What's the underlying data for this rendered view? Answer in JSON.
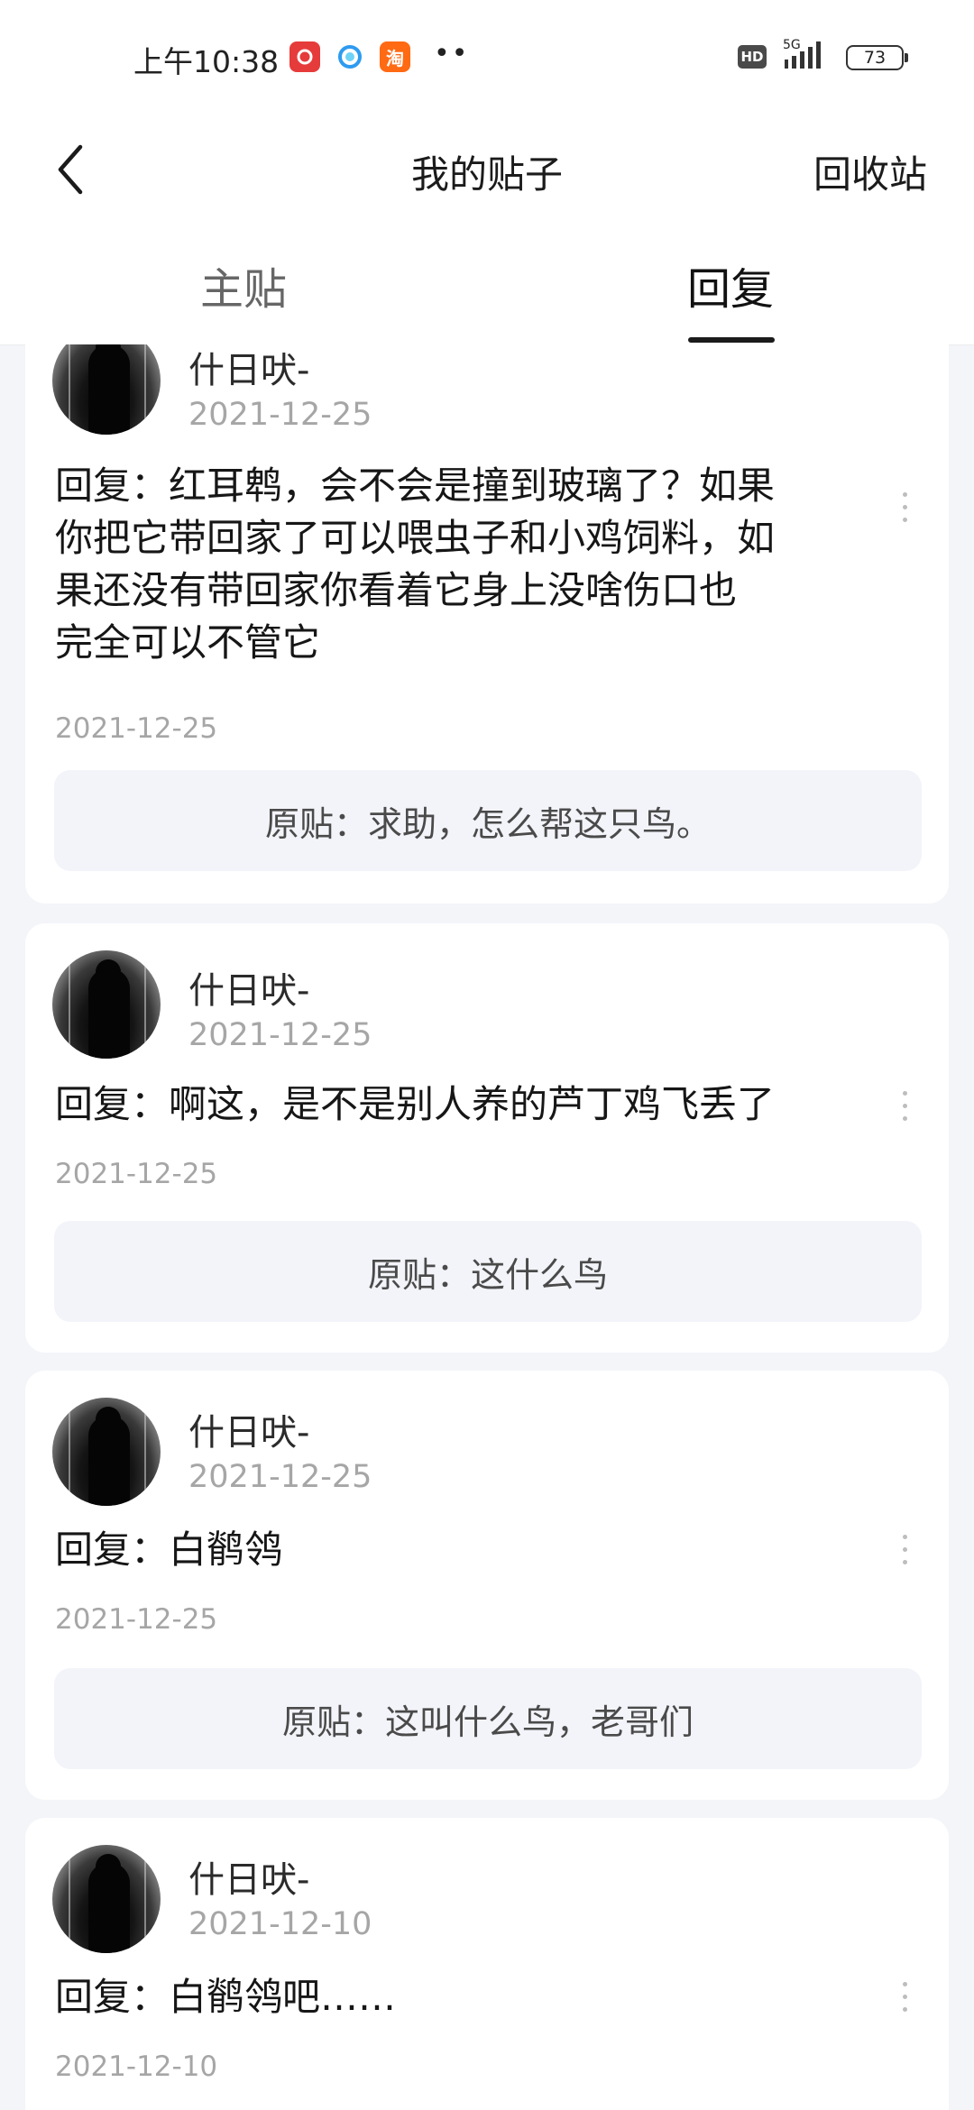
{
  "status_bar": {
    "time": "上午10:38",
    "taobao_icon_text": "淘",
    "hd_label": "HD",
    "network_label": "5G",
    "battery_level": "73"
  },
  "header": {
    "back_icon": "chevron-left-icon",
    "title": "我的贴子",
    "recycle_bin": "回收站"
  },
  "tabs": [
    {
      "label": "主贴",
      "active": false
    },
    {
      "label": "回复",
      "active": true
    }
  ],
  "posts": [
    {
      "username": "什日吠-",
      "user_date": "2021-12-25",
      "reply_lines": [
        "回复：红耳鹎，会不会是撞到玻璃了？如果",
        "你把它带回家了可以喂虫子和小鸡饲料，如",
        "果还没有带回家你看着它身上没啥伤口也",
        "完全可以不管它"
      ],
      "reply_date": "2021-12-25",
      "original_post": "原贴：求助，怎么帮这只鸟。"
    },
    {
      "username": "什日吠-",
      "user_date": "2021-12-25",
      "reply_lines": [
        "回复：啊这，是不是别人养的芦丁鸡飞丢了"
      ],
      "reply_date": "2021-12-25",
      "original_post": "原贴：这什么鸟"
    },
    {
      "username": "什日吠-",
      "user_date": "2021-12-25",
      "reply_lines": [
        "回复：白鹡鸰"
      ],
      "reply_date": "2021-12-25",
      "original_post": "原贴：这叫什么鸟，老哥们"
    },
    {
      "username": "什日吠-",
      "user_date": "2021-12-10",
      "reply_lines": [
        "回复：白鹡鸰吧……"
      ],
      "reply_date": "2021-12-10"
    }
  ]
}
